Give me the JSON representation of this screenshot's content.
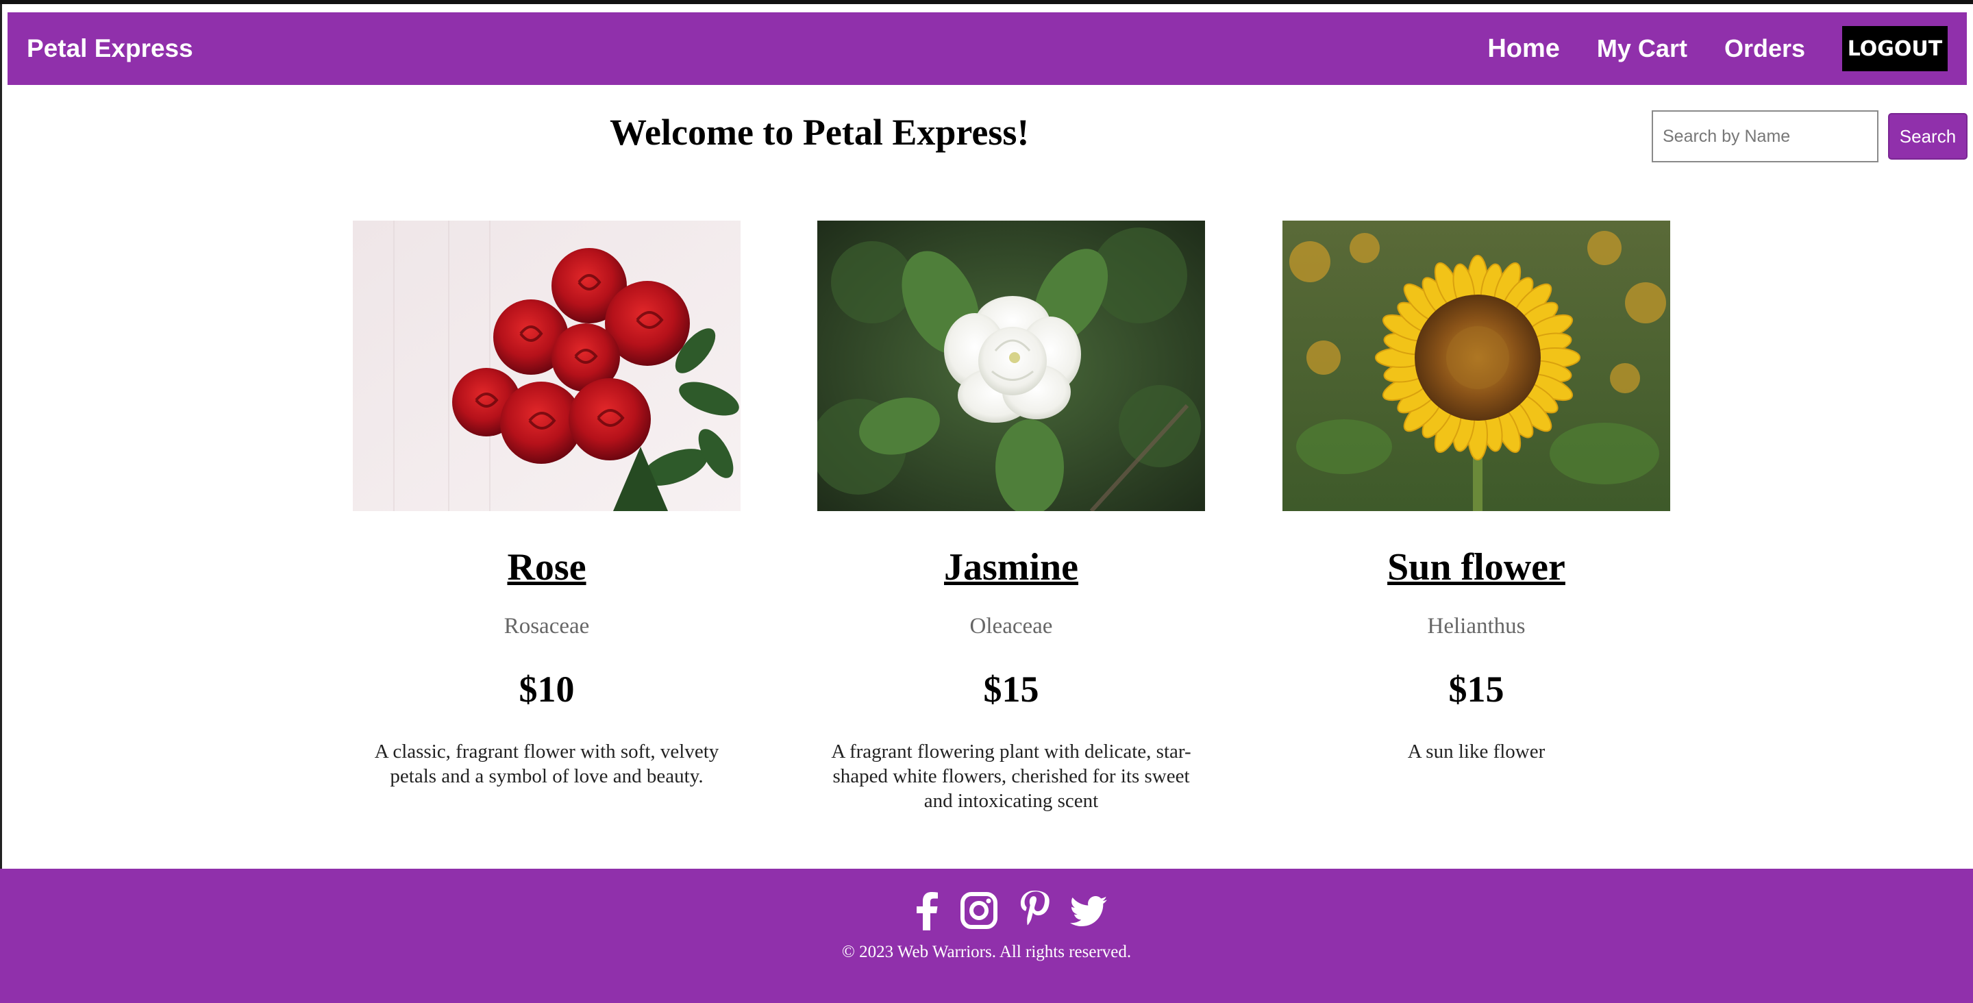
{
  "app": {
    "brand": "Petal Express"
  },
  "nav": {
    "home": "Home",
    "cart": "My Cart",
    "orders": "Orders",
    "logout": "LOGOUT"
  },
  "header": {
    "welcome": "Welcome to Petal Express!"
  },
  "search": {
    "placeholder": "Search by Name",
    "value": "",
    "button": "Search"
  },
  "products": [
    {
      "name": "Rose",
      "family": "Rosaceae",
      "price": "$10",
      "description": "A classic, fragrant flower with soft, velvety petals and a symbol of love and beauty.",
      "image": "red-roses-bouquet"
    },
    {
      "name": "Jasmine",
      "family": "Oleaceae",
      "price": "$15",
      "description": "A fragrant flowering plant with delicate, star-shaped white flowers, cherished for its sweet and intoxicating scent",
      "image": "white-jasmine-flower"
    },
    {
      "name": "Sun flower",
      "family": "Helianthus",
      "price": "$15",
      "description": "A sun like flower",
      "image": "sunflower"
    }
  ],
  "footer": {
    "icons": [
      "facebook-icon",
      "instagram-icon",
      "pinterest-icon",
      "twitter-icon"
    ],
    "copyright": "© 2023 Web Warriors. All rights reserved."
  },
  "colors": {
    "primary": "#9030ab",
    "logout_bg": "#000000"
  }
}
